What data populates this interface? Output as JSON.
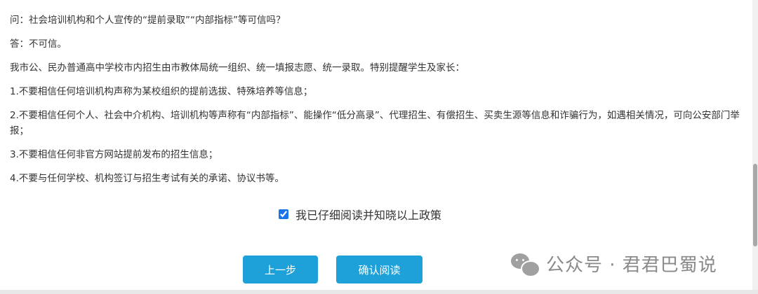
{
  "content": {
    "paragraphs": [
      "问：社会培训机构和个人宣传的“提前录取”“内部指标”等可信吗？",
      "答：不可信。",
      "我市公、民办普通高中学校市内招生由市教体局统一组织、统一填报志愿、统一录取。特别提醒学生及家长：",
      "1.不要相信任何培训机构声称为某校组织的提前选拔、特殊培养等信息；",
      "2.不要相信任何个人、社会中介机构、培训机构等声称有“内部指标”、能操作“低分高录”、代理招生、有偿招生、买卖生源等信息和诈骗行为，如遇相关情况，可向公安部门举报；",
      "3.不要相信任何非官方网站提前发布的招生信息；",
      "4.不要与任何学校、机构签订与招生考试有关的承诺、协议书等。"
    ]
  },
  "agreement": {
    "label": "我已仔细阅读并知晓以上政策",
    "checked": true
  },
  "buttons": {
    "prev_label": "上一步",
    "confirm_label": "确认阅读"
  },
  "watermark": {
    "text": "公众号 · 君君巴蜀说",
    "icon": "wechat-icon"
  },
  "colors": {
    "button_bg": "#1da1d8",
    "button_text": "#ffffff",
    "text": "#333333",
    "watermark": "#8a8a8a"
  }
}
